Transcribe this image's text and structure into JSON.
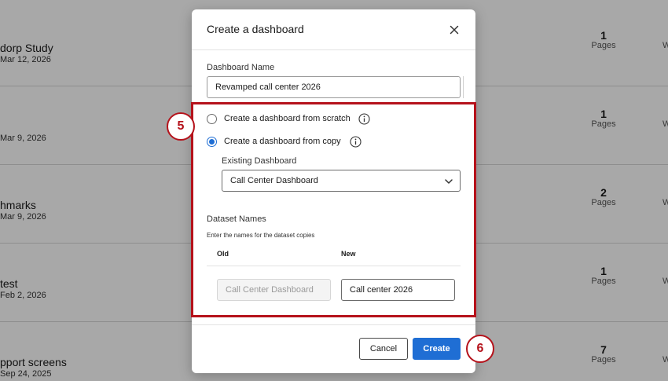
{
  "background_list": [
    {
      "title": "dorp Study",
      "date": "Mar 12, 2026",
      "count": "1",
      "pages_label": "Pages",
      "extra": "W"
    },
    {
      "title": "",
      "date": "Mar 9, 2026",
      "count": "1",
      "pages_label": "Pages",
      "extra": "W"
    },
    {
      "title": "hmarks",
      "date": "Mar 9, 2026",
      "count": "2",
      "pages_label": "Pages",
      "extra": "W"
    },
    {
      "title": "test",
      "date": "Feb 2, 2026",
      "count": "1",
      "pages_label": "Pages",
      "extra": "W"
    },
    {
      "title": "pport screens",
      "date": "Sep 24, 2025",
      "count": "7",
      "pages_label": "Pages",
      "extra": "W"
    }
  ],
  "modal": {
    "title": "Create a dashboard",
    "dashboard_name_label": "Dashboard Name",
    "dashboard_name_value": "Revamped call center 2026",
    "option_scratch": "Create a dashboard from scratch",
    "option_copy": "Create a dashboard from copy",
    "existing_dashboard_label": "Existing Dashboard",
    "existing_dashboard_value": "Call Center Dashboard",
    "dataset_names_label": "Dataset Names",
    "dataset_help": "Enter the names for the dataset copies",
    "col_old": "Old",
    "col_new": "New",
    "old_dataset_placeholder": "Call Center Dashboard",
    "new_dataset_value": "Call center 2026",
    "cancel_label": "Cancel",
    "create_label": "Create"
  },
  "annotations": {
    "step_5": "5",
    "step_6": "6",
    "highlight_color": "#b5121b"
  },
  "colors": {
    "primary": "#1f6ed4"
  }
}
